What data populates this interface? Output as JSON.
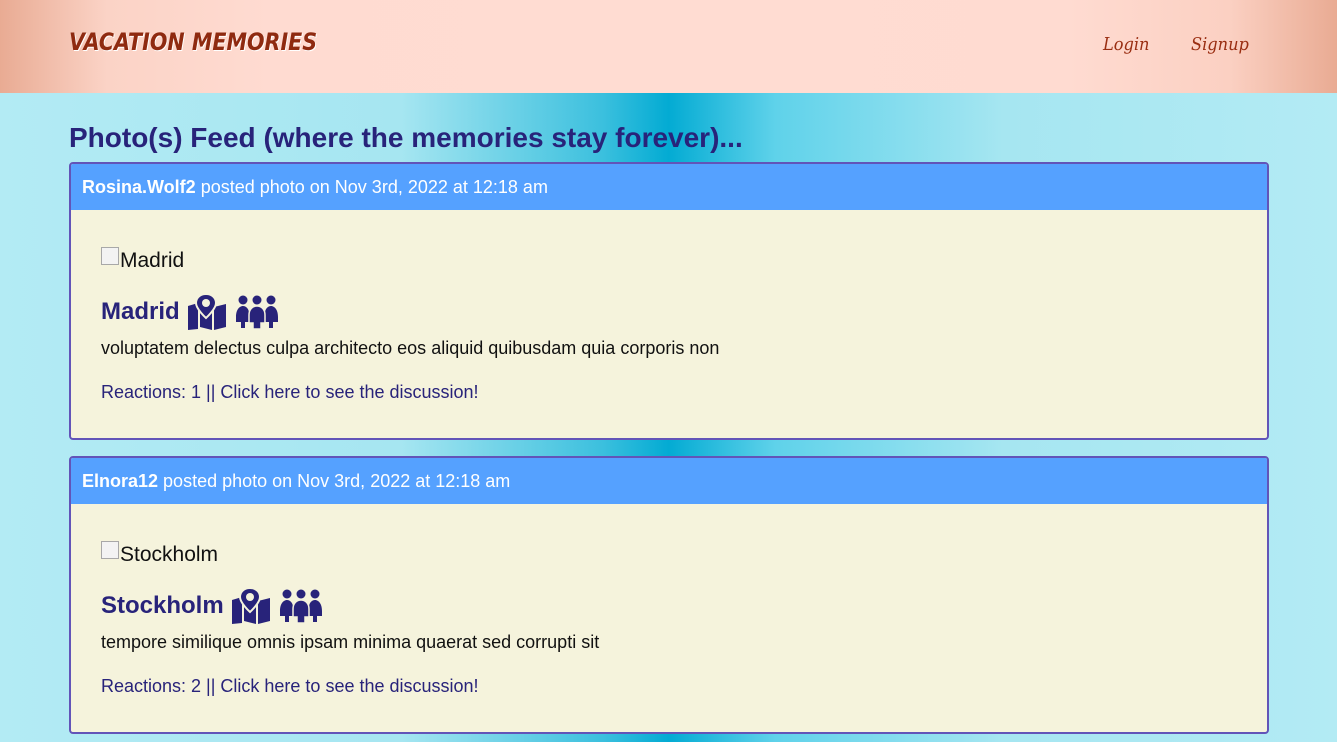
{
  "header": {
    "brand": "VACATION MEMORIES",
    "nav": {
      "login": "Login",
      "signup": "Signup"
    }
  },
  "feed": {
    "title": "Photo(s) Feed (where the memories stay forever)...",
    "posts": [
      {
        "user": "Rosina.Wolf2",
        "posted_text": " posted photo on Nov 3rd, 2022 at 12:18 am",
        "image_alt": "Madrid",
        "place": "Madrid",
        "description": "voluptatem delectus culpa architecto eos aliquid quibusdam quia corporis non",
        "reactions": "Reactions: 1 || Click here to see the discussion!"
      },
      {
        "user": "Elnora12",
        "posted_text": " posted photo on Nov 3rd, 2022 at 12:18 am",
        "image_alt": "Stockholm",
        "place": "Stockholm",
        "description": "tempore similique omnis ipsam minima quaerat sed corrupti sit",
        "reactions": "Reactions: 2 || Click here to see the discussion!"
      }
    ]
  },
  "icons": [
    "map-location-icon",
    "people-group-icon"
  ],
  "colors": {
    "accent": "#28237a",
    "card_header": "#55a1ff",
    "card_bg": "#f5f3dc",
    "card_border": "#6254b8",
    "brand": "#8f2a10"
  }
}
